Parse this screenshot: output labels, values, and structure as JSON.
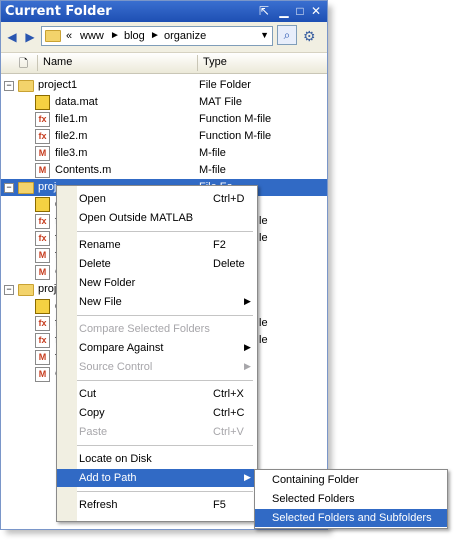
{
  "window": {
    "title": "Current Folder"
  },
  "toolbar": {
    "crumbs": [
      "«",
      "www",
      "blog",
      "organize"
    ]
  },
  "columns": {
    "name": "Name",
    "type": "Type"
  },
  "tree": [
    {
      "name": "project1",
      "type": "File Folder",
      "icon": "folder-icon",
      "expanded": true
    },
    {
      "name": "data.mat",
      "type": "MAT File",
      "icon": "mat-file-icon"
    },
    {
      "name": "file1.m",
      "type": "Function M-file",
      "icon": "function-file-icon"
    },
    {
      "name": "file2.m",
      "type": "Function M-file",
      "icon": "function-file-icon"
    },
    {
      "name": "file3.m",
      "type": "M-file",
      "icon": "m-file-icon"
    },
    {
      "name": "Contents.m",
      "type": "M-file",
      "icon": "m-file-icon"
    },
    {
      "name": "proj",
      "type": "File Fo",
      "icon": "folder-icon",
      "expanded": true
    },
    {
      "name": "d",
      "type": "",
      "icon": "mat-file-icon"
    },
    {
      "name": "f",
      "type": "le",
      "icon": "function-file-icon"
    },
    {
      "name": "f",
      "type": "le",
      "icon": "function-file-icon"
    },
    {
      "name": "f",
      "type": "",
      "icon": "m-file-icon"
    },
    {
      "name": "C",
      "type": "",
      "icon": "m-file-icon"
    },
    {
      "name": "proj",
      "type": "",
      "icon": "folder-icon",
      "expanded": true
    },
    {
      "name": "d",
      "type": "",
      "icon": "mat-file-icon"
    },
    {
      "name": "f",
      "type": "le",
      "icon": "function-file-icon"
    },
    {
      "name": "f",
      "type": "le",
      "icon": "function-file-icon"
    },
    {
      "name": "f",
      "type": "",
      "icon": "m-file-icon"
    },
    {
      "name": "C",
      "type": "",
      "icon": "m-file-icon"
    }
  ],
  "context_menu": [
    {
      "label": "Open",
      "shortcut": "Ctrl+D"
    },
    {
      "label": "Open Outside MATLAB",
      "shortcut": ""
    },
    {
      "sep": true
    },
    {
      "label": "Rename",
      "shortcut": "F2"
    },
    {
      "label": "Delete",
      "shortcut": "Delete"
    },
    {
      "label": "New Folder",
      "shortcut": ""
    },
    {
      "label": "New File",
      "shortcut": "",
      "submenu": true
    },
    {
      "sep": true
    },
    {
      "label": "Compare Selected Folders",
      "shortcut": "",
      "disabled": true
    },
    {
      "label": "Compare Against",
      "shortcut": "",
      "submenu": true
    },
    {
      "label": "Source Control",
      "shortcut": "",
      "submenu": true,
      "disabled": true
    },
    {
      "sep": true
    },
    {
      "label": "Cut",
      "shortcut": "Ctrl+X"
    },
    {
      "label": "Copy",
      "shortcut": "Ctrl+C"
    },
    {
      "label": "Paste",
      "shortcut": "Ctrl+V",
      "disabled": true
    },
    {
      "sep": true
    },
    {
      "label": "Locate on Disk",
      "shortcut": ""
    },
    {
      "label": "Add to Path",
      "shortcut": "",
      "submenu": true,
      "highlighted": true
    },
    {
      "sep": true
    },
    {
      "label": "Refresh",
      "shortcut": "F5"
    }
  ],
  "submenu": [
    {
      "label": "Containing Folder"
    },
    {
      "label": "Selected Folders"
    },
    {
      "label": "Selected Folders and Subfolders",
      "highlighted": true
    }
  ],
  "colors": {
    "selection": "#316ac5",
    "title_bar": "#2a5cc4"
  }
}
